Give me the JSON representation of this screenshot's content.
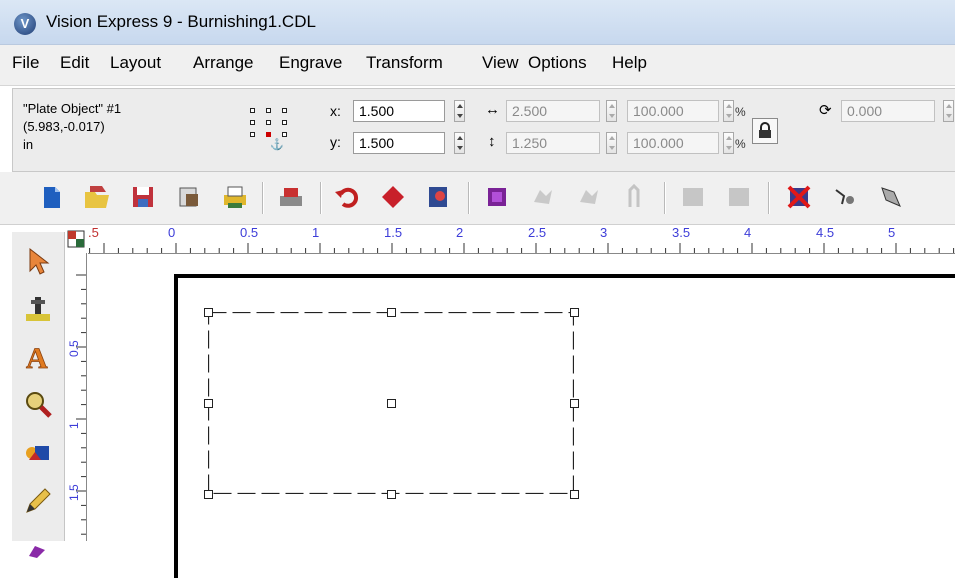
{
  "window": {
    "title": "Vision Express 9 - Burnishing1.CDL",
    "app_icon": "V"
  },
  "menu": [
    "File",
    "Edit",
    "Layout",
    "Arrange",
    "Engrave",
    "Transform",
    "View",
    "Options",
    "Help"
  ],
  "object_info": {
    "name": "\"Plate Object\" #1",
    "coords": "(5.983,-0.017)",
    "units": "in"
  },
  "position": {
    "x_label": "x:",
    "x_value": "1.500",
    "y_label": "y:",
    "y_value": "1.500"
  },
  "size": {
    "width": "2.500",
    "height": "1.250",
    "width_pct": "100.000",
    "height_pct": "100.000",
    "pct_symbol": "%"
  },
  "rotation": {
    "value": "0.000"
  },
  "hruler_labels": [
    ".5",
    "0",
    "0.5",
    "1",
    "1.5",
    "2",
    "2.5",
    "3",
    "3.5",
    "4",
    "4.5",
    "5"
  ],
  "vruler_labels": [
    "0.5",
    "1",
    "1.5"
  ],
  "colors": {
    "ruler_text": "#3c3cd8",
    "title_bar": "#c7d8ee",
    "menu_bar": "#f0f0f0"
  }
}
